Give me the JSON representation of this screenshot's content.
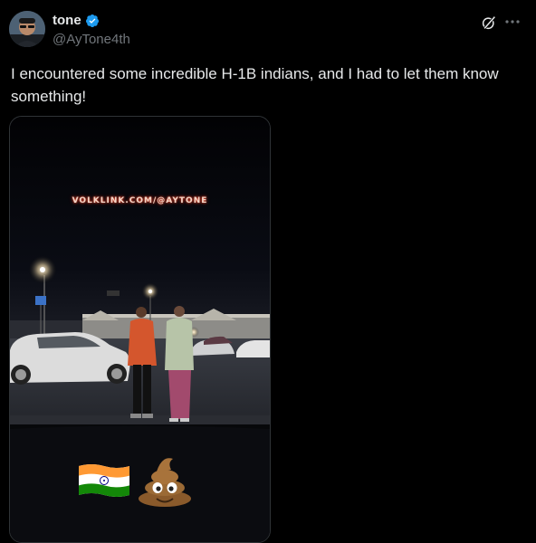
{
  "author": {
    "name": "tone",
    "handle": "@AyTone4th",
    "verified": true,
    "avatar_icon": "avatar-photo"
  },
  "actions": {
    "grok_icon": "grok-icon",
    "more_icon": "more-dots-icon"
  },
  "tweet": {
    "text": "I encountered some incredible H-1B indians, and I had to let them know something!"
  },
  "media": {
    "type": "video",
    "watermark": "VOLKLINK.COM/@AYTONE",
    "overlay_emojis": [
      "india-flag-icon",
      "pile-of-poo-icon"
    ]
  },
  "colors": {
    "background": "#000000",
    "text_primary": "#e7e9ea",
    "text_secondary": "#71767b",
    "verified_blue": "#1d9bf0"
  }
}
